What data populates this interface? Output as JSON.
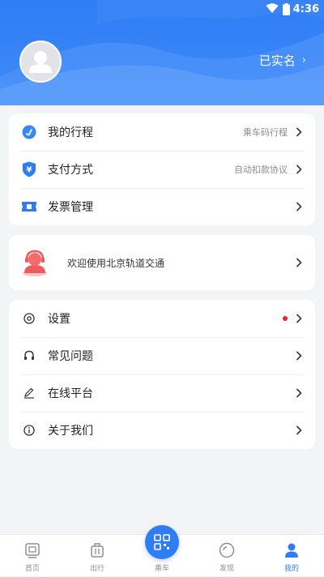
{
  "status_bar": {
    "time": "4:36"
  },
  "profile": {
    "verified_label": "已实名"
  },
  "trip_card": [
    {
      "label": "我的行程",
      "sub": "乘车码行程",
      "icon": "trip-icon"
    },
    {
      "label": "支付方式",
      "sub": "自动扣款协议",
      "icon": "payment-shield-icon"
    },
    {
      "label": "发票管理",
      "sub": "",
      "icon": "invoice-ticket-icon"
    }
  ],
  "welcome": {
    "text": "欢迎使用北京轨道交通",
    "icon": "customer-service-agent-icon"
  },
  "settings_card": [
    {
      "label": "设置",
      "icon": "settings-icon",
      "badge": true
    },
    {
      "label": "常见问题",
      "icon": "headset-icon"
    },
    {
      "label": "在线平台",
      "icon": "edit-icon"
    },
    {
      "label": "关于我们",
      "icon": "info-icon"
    }
  ],
  "tabbar": {
    "home": "首页",
    "trip": "出行",
    "ride": "乘车",
    "discover": "发现",
    "mine": "我的"
  },
  "colors": {
    "accent": "#2f7cf5",
    "badge": "#e0262c"
  }
}
